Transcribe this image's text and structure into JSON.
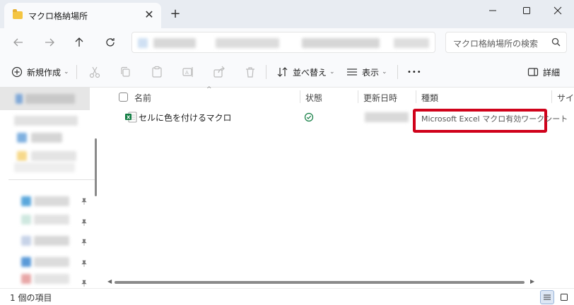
{
  "window": {
    "tab_title": "マクロ格納場所",
    "new_tab": "+",
    "close_tab": "✕"
  },
  "address": {
    "search_placeholder": "マクロ格納場所の検索"
  },
  "commands": {
    "new_label": "新規作成",
    "sort_label": "並べ替え",
    "view_label": "表示",
    "more_label": "•••",
    "details_label": "詳細"
  },
  "columns": {
    "name": "名前",
    "status": "状態",
    "modified": "更新日時",
    "type": "種類",
    "size": "サイズ"
  },
  "files": [
    {
      "name": "セルに色を付けるマクロ",
      "type": "Microsoft Excel マクロ有効ワークシート"
    }
  ],
  "statusbar": {
    "item_count": "1 個の項目"
  },
  "colors": {
    "highlight": "#d0021b",
    "accent": "#0067c0",
    "excel_green": "#107c41"
  }
}
